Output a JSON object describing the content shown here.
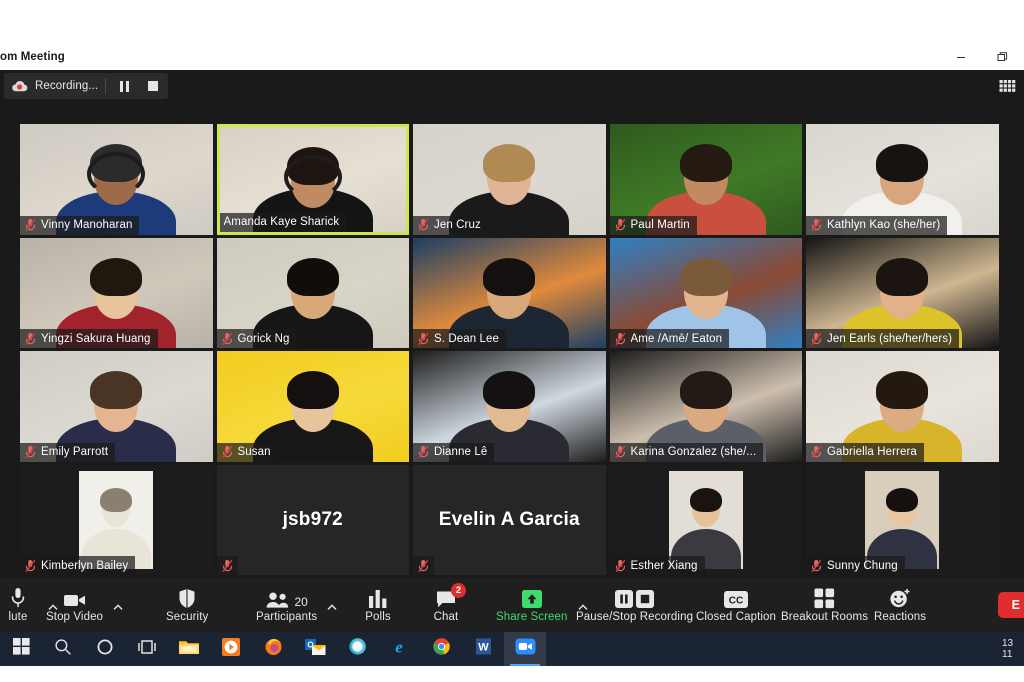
{
  "window": {
    "title": "om Meeting",
    "buttons": [
      {
        "name": "minimize-button",
        "glyph": "minimize"
      },
      {
        "name": "restore-button",
        "glyph": "restore"
      }
    ]
  },
  "topbar": {
    "recording_label": "Recording...",
    "pause_recording_name": "pause-recording-button",
    "stop_recording_name": "stop-recording-button",
    "view_button_label": "View"
  },
  "colors": {
    "active_speaker_border": "#cbe94b",
    "app_background": "#1a1a1a",
    "tile_background": "#262626",
    "toolbar_background": "#1f1f1f",
    "share_green": "#3ddc6d",
    "end_red": "#e02d2d",
    "badge_red": "#e02d2d",
    "taskbar": "#1b2433"
  },
  "grid": {
    "columns": 5,
    "rows": 4,
    "tiles": [
      {
        "id": "vinny-manoharan",
        "name": "Vinny Manoharan",
        "muted": true,
        "active": false,
        "video": true,
        "bg": "#cfcac2",
        "wall": "#ddd7cd",
        "skin": "#9d6b4a",
        "hair": "#2b2b2b",
        "shirt": "#1d3a7a",
        "headset": true
      },
      {
        "id": "amanda-kaye-sharick",
        "name": "Amanda Kaye Sharick",
        "muted": false,
        "active": true,
        "video": true,
        "bg": "#d8d2c6",
        "wall": "#e6e0d4",
        "skin": "#c08a62",
        "hair": "#1f1510",
        "shirt": "#141414",
        "headset": true
      },
      {
        "id": "jen-cruz",
        "name": "Jen Cruz",
        "muted": true,
        "active": false,
        "video": true,
        "bg": "#d5d2cc",
        "wall": "#dcd8d1",
        "skin": "#e0b596",
        "hair": "#b08a55",
        "shirt": "#1a1a1a",
        "headset": false
      },
      {
        "id": "paul-martin",
        "name": "Paul Martin",
        "muted": true,
        "active": false,
        "video": true,
        "bg": "#2f5a1f",
        "wall": "#3f7a25",
        "skin": "#c28a60",
        "hair": "#241a12",
        "shirt": "#c9503f",
        "headset": false
      },
      {
        "id": "kathlyn-kao",
        "name": "Kathlyn Kao (she/her)",
        "muted": true,
        "active": false,
        "video": true,
        "bg": "#d9d6d0",
        "wall": "#e4e1db",
        "skin": "#d9a57d",
        "hair": "#171310",
        "shirt": "#f2f0ec",
        "headset": false
      },
      {
        "id": "yingzi-sakura-huang",
        "name": "Yingzi Sakura Huang",
        "muted": true,
        "active": false,
        "video": true,
        "bg": "#b9b2a6",
        "wall": "#cfc8bb",
        "skin": "#e8c49c",
        "hair": "#20170f",
        "shirt": "#a2232c",
        "headset": false
      },
      {
        "id": "gorick-ng",
        "name": "Gorick Ng",
        "muted": true,
        "active": false,
        "video": true,
        "bg": "#cfcabe",
        "wall": "#d9d4c8",
        "skin": "#d8a878",
        "hair": "#120d0a",
        "shirt": "#161616",
        "headset": false
      },
      {
        "id": "s-dean-lee",
        "name": "S. Dean Lee",
        "muted": true,
        "active": false,
        "video": true,
        "bg": "#1b3f63",
        "wall": "#e08a3c",
        "skin": "#d9a87a",
        "hair": "#141010",
        "shirt": "#1d2733",
        "headset": false
      },
      {
        "id": "ame-eaton",
        "name": "Ame /Āmē/ Eaton",
        "muted": true,
        "active": false,
        "video": true,
        "bg": "#2f7fc4",
        "wall": "#8a4a33",
        "skin": "#e0b58f",
        "hair": "#7a5a38",
        "shirt": "#9fc4e8",
        "headset": false
      },
      {
        "id": "jen-earls",
        "name": "Jen Earls (she/her/hers)",
        "muted": true,
        "active": false,
        "video": true,
        "bg": "#151515",
        "wall": "#ceb690",
        "skin": "#e2b188",
        "hair": "#1b1410",
        "shirt": "#ddc32a",
        "headset": false
      },
      {
        "id": "emily-parrott",
        "name": "Emily Parrott",
        "muted": true,
        "active": false,
        "video": true,
        "bg": "#cfccc6",
        "wall": "#dcd9d3",
        "skin": "#e3b591",
        "hair": "#4a3525",
        "shirt": "#2a2d4a",
        "headset": false
      },
      {
        "id": "susan",
        "name": "Susan",
        "muted": true,
        "active": false,
        "video": true,
        "bg": "#f2cc1f",
        "wall": "#f6d93a",
        "skin": "#e8c49c",
        "hair": "#141010",
        "shirt": "#171717",
        "headset": false
      },
      {
        "id": "dianne-le",
        "name": "Dianne Lê",
        "muted": true,
        "active": false,
        "video": true,
        "bg": "#1c1c1c",
        "wall": "#cfd8e0",
        "skin": "#e2ba92",
        "hair": "#151012",
        "shirt": "#2a2a33",
        "headset": false
      },
      {
        "id": "karina-gonzalez",
        "name": "Karina Gonzalez (she/...",
        "muted": true,
        "active": false,
        "video": true,
        "bg": "#1c1c1c",
        "wall": "#cdbfae",
        "skin": "#dba97f",
        "hair": "#221a14",
        "shirt": "#5a5f68",
        "headset": false
      },
      {
        "id": "gabriella-herrera",
        "name": "Gabriella Herrera",
        "muted": true,
        "active": false,
        "video": true,
        "bg": "#ddd8cf",
        "wall": "#e8e4dc",
        "skin": "#dcab81",
        "hair": "#23190f",
        "shirt": "#d8b42a",
        "headset": false
      },
      {
        "id": "kimberlyn-bailey",
        "name": "Kimberlyn Bailey",
        "muted": true,
        "active": false,
        "video": true,
        "bg": "#1c1c1c",
        "wall": "#f0efea",
        "skin": "#e8e4d8",
        "hair": "#8a8070",
        "shirt": "#e8e4d8",
        "headset": false,
        "inset": true
      },
      {
        "id": "jsb972",
        "name": "",
        "center_name": "jsb972",
        "muted": true,
        "active": false,
        "video": false,
        "bg": "#262626"
      },
      {
        "id": "evelin-a-garcia",
        "name": "",
        "center_name": "Evelin A Garcia",
        "muted": true,
        "active": false,
        "video": false,
        "bg": "#262626"
      },
      {
        "id": "esther-xiang",
        "name": "Esther Xiang",
        "muted": true,
        "active": false,
        "video": true,
        "bg": "#1c1c1c",
        "wall": "#e2ded6",
        "skin": "#e6c29a",
        "hair": "#1a1310",
        "shirt": "#3a3a40",
        "headset": false,
        "inset": true
      },
      {
        "id": "sunny-chung",
        "name": "Sunny Chung",
        "muted": true,
        "active": false,
        "video": true,
        "bg": "#1c1c1c",
        "wall": "#d9cdbb",
        "skin": "#e8c6a0",
        "hair": "#171010",
        "shirt": "#2f3240",
        "headset": false,
        "inset": true
      }
    ]
  },
  "toolbar": {
    "items": [
      {
        "name": "mute-button",
        "label": "lute",
        "icon": "microphone-icon",
        "caret": true,
        "style": "plain"
      },
      {
        "name": "stop-video-button",
        "label": "Stop Video",
        "icon": "video-camera-icon",
        "caret": true,
        "style": "plain"
      },
      {
        "name": "security-button",
        "label": "Security",
        "icon": "shield-icon",
        "caret": false,
        "style": "plain"
      },
      {
        "name": "participants-button",
        "label": "Participants",
        "icon": "participants-icon",
        "caret": true,
        "style": "plain",
        "count": "20"
      },
      {
        "name": "polls-button",
        "label": "Polls",
        "icon": "polls-bar-chart-icon",
        "caret": false,
        "style": "plain"
      },
      {
        "name": "chat-button",
        "label": "Chat",
        "icon": "chat-bubble-icon",
        "caret": false,
        "style": "plain",
        "badge": "2"
      },
      {
        "name": "share-screen-button",
        "label": "Share Screen",
        "icon": "share-screen-up-arrow-icon",
        "caret": true,
        "style": "green"
      },
      {
        "name": "pause-stop-recording-button",
        "label": "Pause/Stop Recording",
        "icon": "pause-stop-recording-icon",
        "caret": false,
        "style": "plain"
      },
      {
        "name": "closed-caption-button",
        "label": "Closed Caption",
        "icon": "closed-caption-cc-icon",
        "caret": false,
        "style": "plain"
      },
      {
        "name": "breakout-rooms-button",
        "label": "Breakout Rooms",
        "icon": "breakout-rooms-grid-icon",
        "caret": false,
        "style": "plain"
      },
      {
        "name": "reactions-button",
        "label": "Reactions",
        "icon": "reactions-smiley-icon",
        "caret": false,
        "style": "plain"
      }
    ],
    "end_label": "E"
  },
  "taskbar": {
    "items": [
      {
        "name": "start-button",
        "icon": "windows-start-icon"
      },
      {
        "name": "search-button",
        "icon": "search-icon"
      },
      {
        "name": "cortana-button",
        "icon": "cortana-circle-icon"
      },
      {
        "name": "task-view-button",
        "icon": "task-view-icon"
      },
      {
        "name": "file-explorer-button",
        "icon": "file-explorer-folder-icon"
      },
      {
        "name": "media-player-button",
        "icon": "media-player-play-icon"
      },
      {
        "name": "firefox-button",
        "icon": "firefox-icon"
      },
      {
        "name": "outlook-button",
        "icon": "outlook-mail-icon"
      },
      {
        "name": "skype-button",
        "icon": "skype-icon"
      },
      {
        "name": "internet-explorer-button",
        "icon": "internet-explorer-e-icon"
      },
      {
        "name": "chrome-button",
        "icon": "chrome-icon"
      },
      {
        "name": "word-button",
        "icon": "microsoft-word-icon"
      },
      {
        "name": "zoom-button",
        "icon": "zoom-camera-icon",
        "active": true
      }
    ],
    "clock_time": "13",
    "clock_date": "11"
  }
}
